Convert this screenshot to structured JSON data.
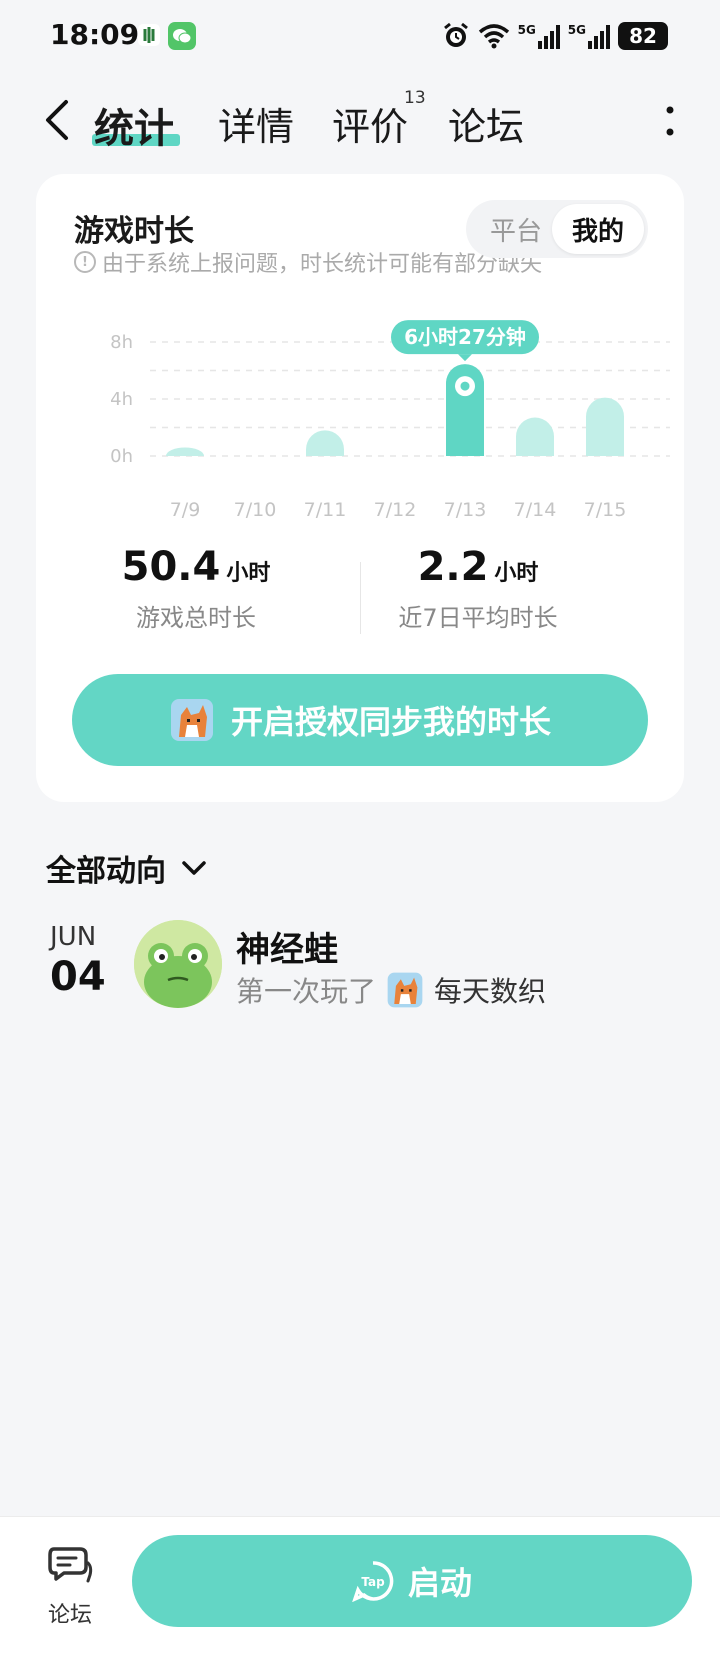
{
  "status_bar": {
    "time": "18:09",
    "battery": "82",
    "network_1": "5G",
    "network_2": "5G"
  },
  "nav": {
    "tabs": [
      {
        "label": "统计"
      },
      {
        "label": "详情"
      },
      {
        "label": "评价"
      },
      {
        "label": "论坛"
      }
    ],
    "review_badge": "13",
    "accent": "#5fd6c4"
  },
  "playtime": {
    "title": "游戏时长",
    "note": "由于系统上报问题，时长统计可能有部分缺失",
    "segment": {
      "option_platform": "平台",
      "option_mine": "我的",
      "selected": "我的"
    },
    "stats": {
      "total_value": "50.4",
      "total_unit": "小时",
      "total_label": "游戏总时长",
      "avg_value": "2.2",
      "avg_unit": "小时",
      "avg_label": "近7日平均时长"
    },
    "sync_button": "开启授权同步我的时长"
  },
  "chart_data": {
    "type": "bar",
    "categories": [
      "7/9",
      "7/10",
      "7/11",
      "7/12",
      "7/13",
      "7/14",
      "7/15"
    ],
    "values": [
      0.6,
      0,
      1.8,
      0,
      6.45,
      2.7,
      4.1
    ],
    "ylim": [
      0,
      8
    ],
    "yticks": [
      "0h",
      "4h",
      "8h"
    ],
    "highlight_index": 4,
    "highlight_label": "6小时27分钟",
    "grid": true,
    "colors": {
      "bar": "#c2efe8",
      "highlight": "#5fd6c4"
    }
  },
  "feed": {
    "title": "全部动向",
    "items": [
      {
        "month": "JUN",
        "day": "04",
        "name": "神经蛙",
        "action": "第一次玩了",
        "game": "每天数织"
      }
    ]
  },
  "bottom_bar": {
    "forum_label": "论坛",
    "launch_label": "启动",
    "launch_icon_text": "Tap"
  }
}
